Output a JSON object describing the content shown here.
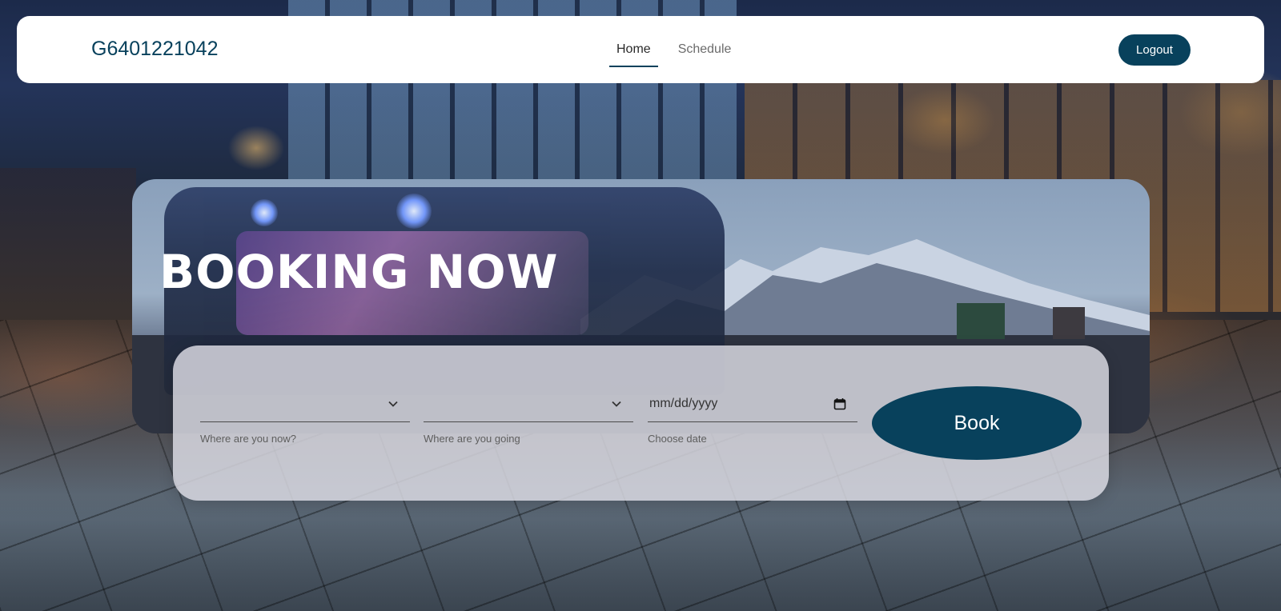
{
  "navbar": {
    "brand": "G6401221042",
    "links": [
      {
        "label": "Home",
        "active": true
      },
      {
        "label": "Schedule",
        "active": false
      }
    ],
    "logout_label": "Logout"
  },
  "hero": {
    "title": "BOOKING NOW"
  },
  "booking_form": {
    "from": {
      "value": "",
      "helper": "Where are you now?",
      "icon": "chevron-down-icon"
    },
    "to": {
      "value": "",
      "helper": "Where are you going",
      "icon": "chevron-down-icon"
    },
    "date": {
      "placeholder": "mm/dd/yyyy",
      "helper": "Choose date",
      "icon": "calendar-icon"
    },
    "book_label": "Book"
  },
  "colors": {
    "primary": "#08415c",
    "navbar_bg": "#ffffff",
    "form_bg": "#dedee6"
  }
}
